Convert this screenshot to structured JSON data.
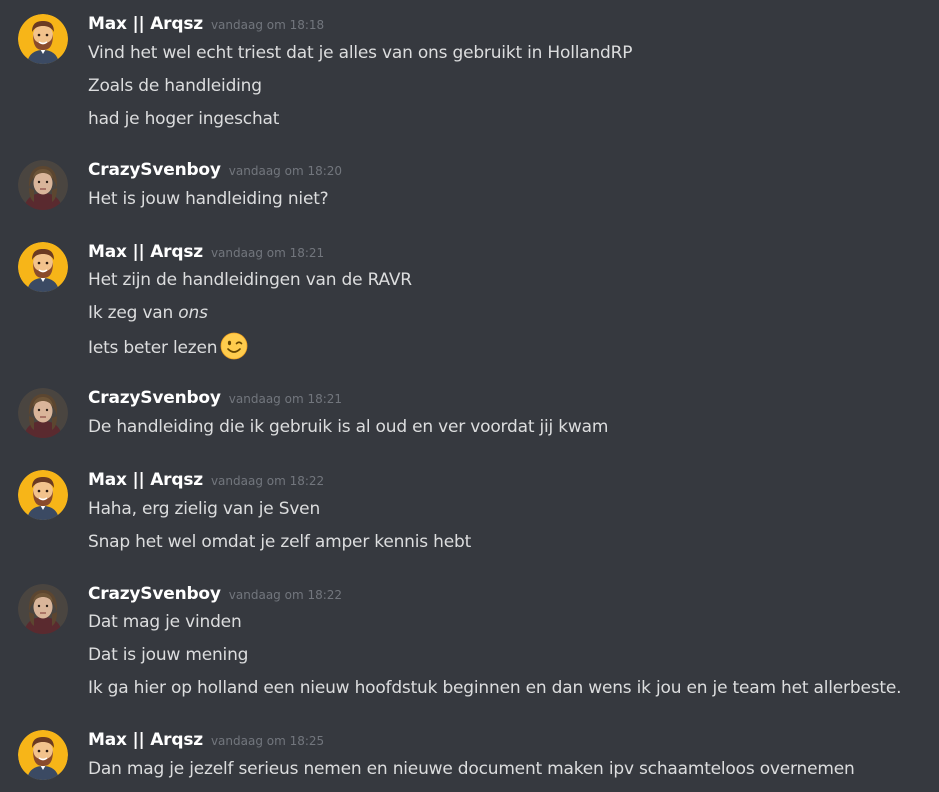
{
  "users": {
    "max": "Max || Arqsz",
    "sven": "CrazySvenboy"
  },
  "colors": {
    "background": "#36393f",
    "username": "#ffffff",
    "message_text": "#dcddde",
    "timestamp": "#72767d",
    "max_avatar_bg": "#f7b518"
  },
  "messages": [
    {
      "author": "Max || Arqsz",
      "time": "vandaag om 18:18",
      "lines": [
        "Vind het wel echt triest dat je alles van ons gebruikt in HollandRP",
        "Zoals de handleiding",
        "had je hoger ingeschat"
      ]
    },
    {
      "author": "CrazySvenboy",
      "time": "vandaag om 18:20",
      "lines": [
        "Het is jouw handleiding niet?"
      ]
    },
    {
      "author": "Max || Arqsz",
      "time": "vandaag om 18:21",
      "lines": [
        "Het zijn de handleidingen van de RAVR",
        "Ik zeg van ",
        "Iets beter lezen"
      ],
      "italic": "ons",
      "emoji": "winking-face-emoji"
    },
    {
      "author": "CrazySvenboy",
      "time": "vandaag om 18:21",
      "lines": [
        "De handleiding die ik gebruik is al oud en ver voordat jij kwam"
      ]
    },
    {
      "author": "Max || Arqsz",
      "time": "vandaag om 18:22",
      "lines": [
        "Haha, erg zielig van je Sven",
        "Snap het wel omdat je zelf amper kennis hebt"
      ]
    },
    {
      "author": "CrazySvenboy",
      "time": "vandaag om 18:22",
      "lines": [
        "Dat mag je vinden",
        "Dat is jouw mening",
        "Ik ga hier op holland een nieuw hoofdstuk beginnen en dan wens ik jou en je team het allerbeste."
      ]
    },
    {
      "author": "Max || Arqsz",
      "time": "vandaag om 18:25",
      "lines": [
        "Dan mag je jezelf serieus nemen en nieuwe document maken ipv schaamteloos overnemen"
      ]
    }
  ]
}
